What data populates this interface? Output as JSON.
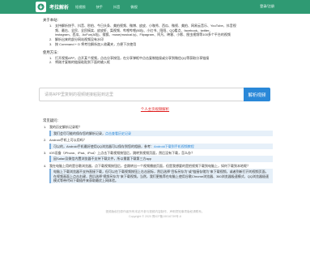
{
  "nav": {
    "brand": "考拉解析",
    "items": [
      "短视频",
      "快手",
      "抖音",
      "微视"
    ],
    "right": "登录/注册",
    "brand_color": "#2f9a73"
  },
  "supported": {
    "title": "关于本站:",
    "items": [
      {
        "n": "1.",
        "text": "支持解析快手、抖音、秒拍、今日头条、美拍视频、微博、皮皮、小咖秀、西瓜、微视、美拍、网易云音乐、YouTube、抖音视"
      },
      {
        "n": "",
        "text": "频、最右、全民、全民搞笑、皮皮虾、梨视频、哔哩哔哩(B站)、小红书、陌陌、QQ看点、facebook、twitter、"
      },
      {
        "n": "",
        "text": "instagram、西瓜、AcFun(A站)、搜狐、muse(musical.ly)、Flipagram、阿凡、映客、小影、图虫视频等100多个平台的视频"
      },
      {
        "n": "2.",
        "text": "解析出来的部分网站视频没有水印"
      },
      {
        "n": "3.",
        "text": "按 Command + D 将考拉解析加入收藏夹，方便下次使用"
      }
    ]
  },
  "usage": {
    "title": "使用方法:",
    "items": [
      {
        "n": "1.",
        "text": "打开视频APP，点开某个视频，点击分享按钮，在分享弹框中点击复制链接或分享到微信QQ等获取分享链接"
      },
      {
        "n": "2.",
        "text": "将刚才复制的链接粘贴到下面的输入框"
      }
    ]
  },
  "search": {
    "placeholder": "请将APP里复制的视频链接粘贴到这里",
    "button": "解析视频"
  },
  "personal_link": "个人主页视频解析",
  "faq": {
    "title": "常见疑问:",
    "items": [
      {
        "n": "1.",
        "q": "我的历史解析记录呢？",
        "a_prefix": "我们会尽可能的保存您的解析记录，",
        "a_link": "点击查看历史记录"
      },
      {
        "n": "2.",
        "q": "Android手机上可以用吗？",
        "a_prefix": "可以的，Android手机最好使用QQ浏览器可以保存到您的相册，参考：",
        "a_link": "Android下载到手机视频教程"
      },
      {
        "n": "3.",
        "q": "iOS设备（iPhone、iPad、iPod）上点击下载视频按钮后，跳转到视频页面，然后没有下载，怎么办？",
        "a_prefix": "因Safari及微信内置浏览器不支持下载文件，所以需要下载第三方app",
        "a_link": ""
      },
      {
        "n": "4.",
        "q": "我在电脑上用的是谷歌浏览器，点下载视频按钮后，会跳转出一个视频播放页面，但是我想要的是把视频下载到电脑上，如何下载到本地呢？",
        "a_prefix": "电脑上下载浏览器不支持直接下载，但可以在下载视频按钮上右击鼠标，然后选择\"目标另存为\"或\"链接存储为\"来下载视频，或者到新打开的视频页面，在视频画面上点击右键，然后选择\"视频另存为\"来下载视频。当然，我们更推荐在电脑上使用谷歌Chrome浏览器、360浏览器极速模式、QQ浏览器极速模式等带代码下载插件来获取最优上网体验。",
        "a_link": ""
      }
    ]
  },
  "footer": {
    "line1": "视频版权归原作者所有本站不参与视频内容制作，声明须知事项版权请联系。",
    "line2": "Copyright © 2020 豫ICP备19016739号-6"
  }
}
